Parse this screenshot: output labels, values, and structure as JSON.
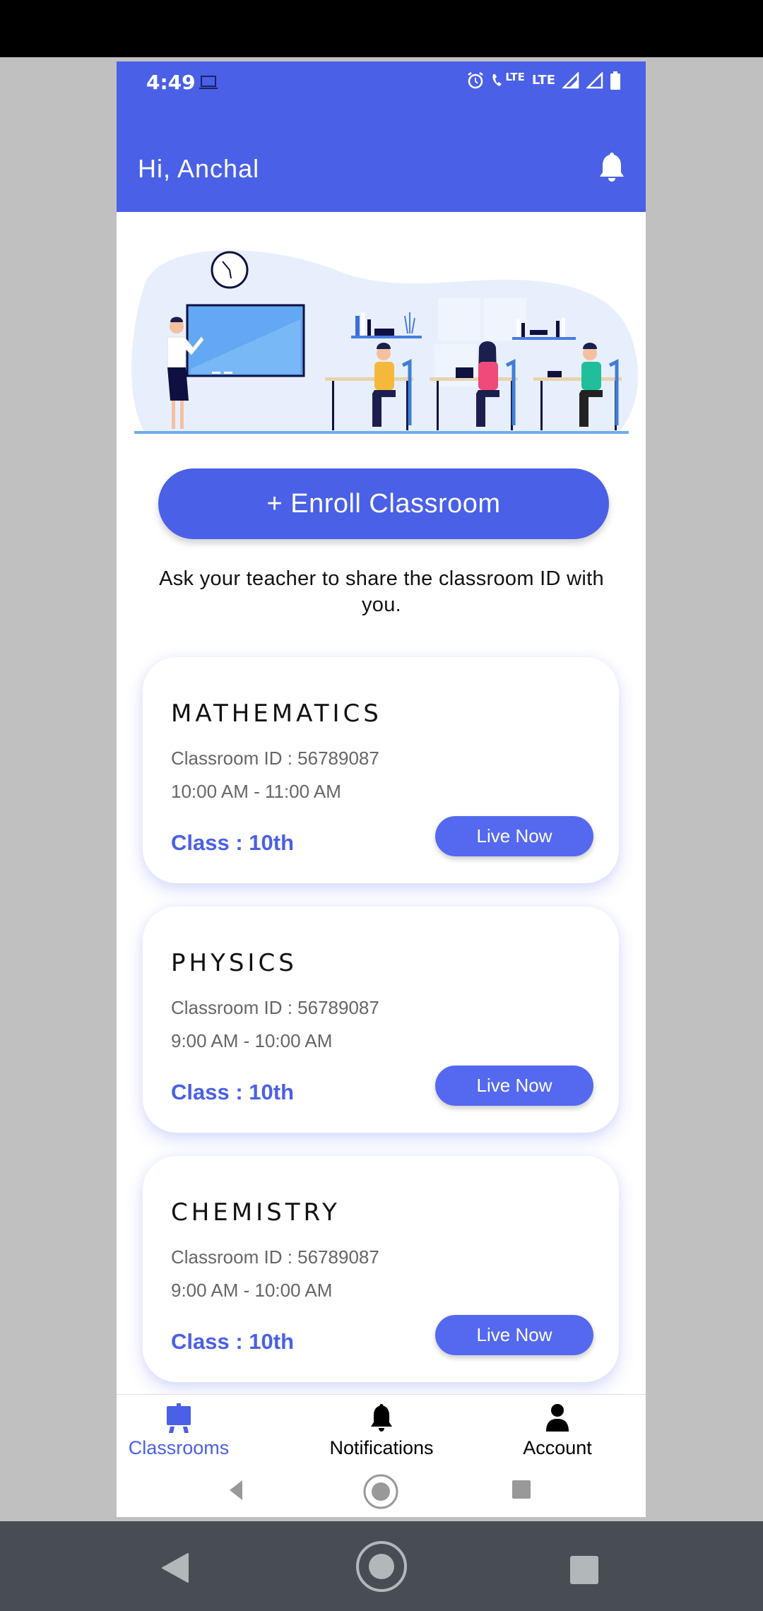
{
  "status_bar": {
    "time": "4:49",
    "icons": [
      "laptop-icon",
      "alarm-icon",
      "volte-call-icon",
      "lte-icon",
      "signal-icon",
      "signal-icon",
      "battery-icon"
    ],
    "lte_label_1": "LTE",
    "lte_label_2": "LTE"
  },
  "header": {
    "greeting": "Hi, Anchal",
    "notification_icon": "bell-icon"
  },
  "hero": {
    "illustration": "classroom-illustration"
  },
  "enroll": {
    "button_label": "+ Enroll Classroom",
    "helper_text": "Ask your teacher to share the classroom ID with you."
  },
  "classrooms": [
    {
      "subject": "MATHEMATICS",
      "classroom_id": "Classroom ID : 56789087",
      "time": "10:00 AM - 11:00 AM",
      "class": "Class : 10th",
      "action_label": "Live Now"
    },
    {
      "subject": "PHYSICS",
      "classroom_id": "Classroom ID : 56789087",
      "time": "9:00 AM - 10:00 AM",
      "class": "Class : 10th",
      "action_label": "Live Now"
    },
    {
      "subject": "CHEMISTRY",
      "classroom_id": "Classroom ID : 56789087",
      "time": "9:00 AM - 10:00 AM",
      "class": "Class : 10th",
      "action_label": "Live Now"
    }
  ],
  "bottom_nav": {
    "items": [
      {
        "label": "Classrooms",
        "icon": "easel-icon",
        "active": true
      },
      {
        "label": "Notifications",
        "icon": "bell-icon",
        "active": false
      },
      {
        "label": "Account",
        "icon": "person-icon",
        "active": false
      }
    ]
  },
  "system_nav": {
    "buttons": [
      "back",
      "home",
      "recents"
    ]
  },
  "colors": {
    "primary": "#4a60e6",
    "button": "#5469f0",
    "text_muted": "#666666",
    "outer_nav": "#474d53",
    "backdrop": "#c0c0c0"
  }
}
